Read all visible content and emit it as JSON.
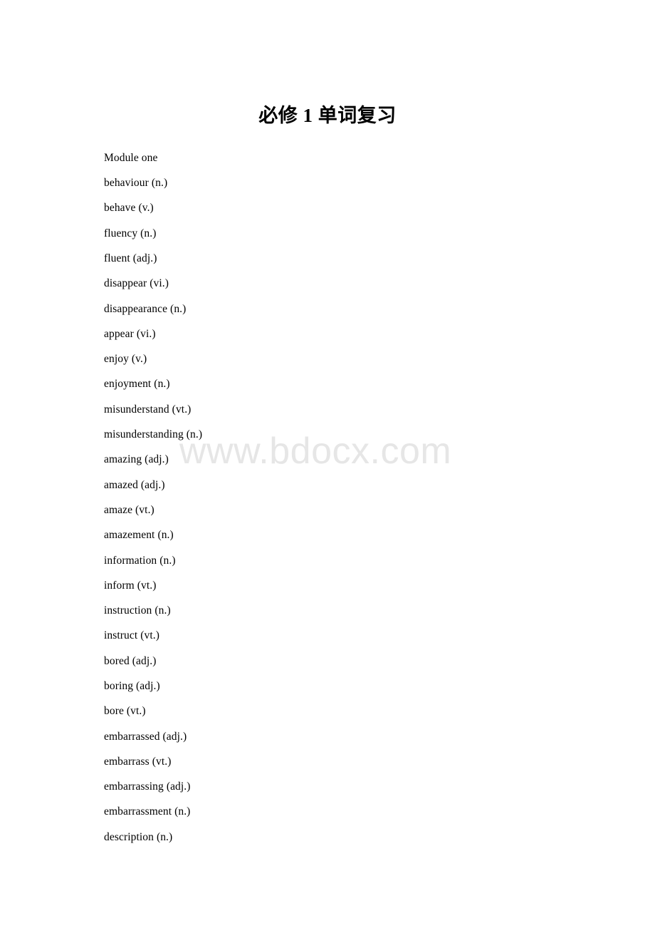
{
  "document": {
    "title": "必修 1 单词复习",
    "watermark": "www.bdocx.com",
    "section_heading": "Module one",
    "words": [
      "Module one",
      "behaviour (n.)",
      "behave (v.)",
      "fluency (n.)",
      "fluent (adj.)",
      "disappear (vi.)",
      "disappearance (n.)",
      "appear (vi.)",
      "enjoy (v.)",
      "enjoyment (n.)",
      "misunderstand (vt.)",
      "misunderstanding (n.)",
      "amazing (adj.)",
      "amazed (adj.)",
      "amaze (vt.)",
      "amazement (n.)",
      "information (n.)",
      "inform (vt.)",
      "instruction (n.)",
      "instruct (vt.)",
      "bored (adj.)",
      "boring (adj.)",
      "bore (vt.)",
      "embarrassed (adj.)",
      "embarrass (vt.)",
      "embarrassing (adj.)",
      "embarrassment (n.)",
      "description (n.)"
    ]
  },
  "colors": {
    "text": "#000000",
    "background": "#ffffff",
    "watermark": "#e6e6e6"
  }
}
